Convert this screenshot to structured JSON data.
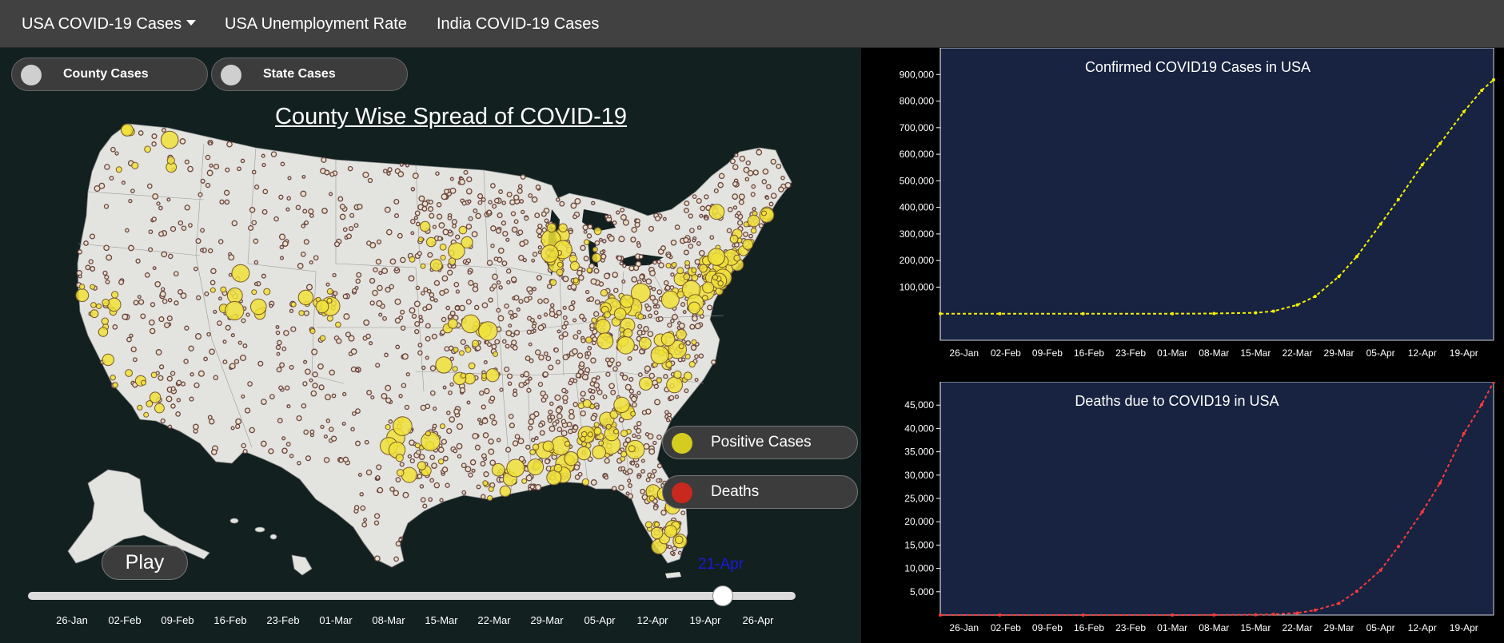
{
  "nav": {
    "items": [
      {
        "label": "USA COVID-19 Cases",
        "dropdown": true
      },
      {
        "label": "USA Unemployment Rate"
      },
      {
        "label": "India COVID-19 Cases"
      }
    ]
  },
  "toggles": {
    "county_label": "County Cases",
    "state_label": "State Cases"
  },
  "map": {
    "title": "County Wise Spread of COVID-19"
  },
  "legend": {
    "positive_label": "Positive Cases",
    "positive_color": "#d4cc1e",
    "deaths_label": "Deaths",
    "deaths_color": "#c8281e"
  },
  "controls": {
    "play_label": "Play",
    "current_date": "21-Apr",
    "slider_value_fraction": 0.905,
    "slider_ticks": [
      "26-Jan",
      "02-Feb",
      "09-Feb",
      "16-Feb",
      "23-Feb",
      "01-Mar",
      "08-Mar",
      "15-Mar",
      "22-Mar",
      "29-Mar",
      "05-Apr",
      "12-Apr",
      "19-Apr",
      "26-Apr"
    ]
  },
  "colors": {
    "nav_bg": "#414141",
    "left_bg": "#122020",
    "chart_bg": "#172340",
    "land": "#e3e3df",
    "county_dot": "#6b4543",
    "case_bubble": "#f0e23a"
  },
  "chart_data": [
    {
      "type": "line",
      "title": "Confirmed COVID19 Cases in USA",
      "x_tick_labels": [
        "26-Jan",
        "02-Feb",
        "09-Feb",
        "16-Feb",
        "23-Feb",
        "01-Mar",
        "08-Mar",
        "15-Mar",
        "22-Mar",
        "29-Mar",
        "05-Apr",
        "12-Apr",
        "19-Apr"
      ],
      "y_tick_labels": [
        "100,000",
        "200,000",
        "300,000",
        "400,000",
        "500,000",
        "600,000",
        "700,000",
        "800,000",
        "900,000"
      ],
      "ylim": [
        -100000,
        1000000
      ],
      "series_color": "#f5f000",
      "x_day_range": [
        "22-Jan",
        "24-Apr"
      ],
      "series": [
        {
          "x": [
            "22-Jan",
            "01-Feb",
            "15-Feb",
            "01-Mar",
            "08-Mar",
            "15-Mar",
            "18-Mar",
            "22-Mar",
            "25-Mar",
            "29-Mar",
            "01-Apr",
            "05-Apr",
            "08-Apr",
            "12-Apr",
            "15-Apr",
            "19-Apr",
            "22-Apr",
            "24-Apr"
          ],
          "values": [
            0,
            8,
            15,
            75,
            540,
            3500,
            9400,
            33000,
            65000,
            140000,
            215000,
            337000,
            430000,
            560000,
            640000,
            760000,
            840000,
            880000
          ]
        }
      ]
    },
    {
      "type": "line",
      "title": "Deaths due to COVID19 in USA",
      "x_tick_labels": [
        "26-Jan",
        "02-Feb",
        "09-Feb",
        "16-Feb",
        "23-Feb",
        "01-Mar",
        "08-Mar",
        "15-Mar",
        "22-Mar",
        "29-Mar",
        "05-Apr",
        "12-Apr",
        "19-Apr"
      ],
      "y_tick_labels": [
        "5,000",
        "10,000",
        "15,000",
        "20,000",
        "25,000",
        "30,000",
        "35,000",
        "40,000",
        "45,000"
      ],
      "ylim": [
        0,
        50000
      ],
      "series_color": "#ff3a3a",
      "x_day_range": [
        "22-Jan",
        "24-Apr"
      ],
      "series": [
        {
          "x": [
            "22-Jan",
            "01-Feb",
            "15-Feb",
            "01-Mar",
            "08-Mar",
            "15-Mar",
            "18-Mar",
            "22-Mar",
            "25-Mar",
            "29-Mar",
            "01-Apr",
            "05-Apr",
            "08-Apr",
            "12-Apr",
            "15-Apr",
            "19-Apr",
            "22-Apr",
            "24-Apr"
          ],
          "values": [
            0,
            0,
            0,
            1,
            22,
            68,
            155,
            430,
            1050,
            2500,
            5100,
            9600,
            14700,
            22100,
            28300,
            38900,
            45100,
            50000
          ]
        }
      ]
    }
  ]
}
